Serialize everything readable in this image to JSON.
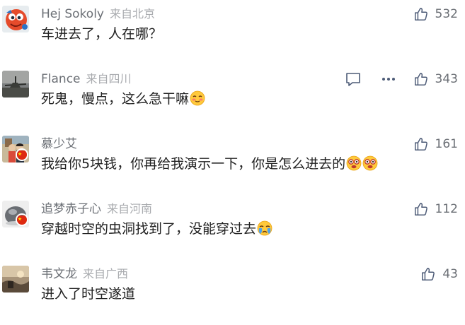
{
  "comments": [
    {
      "username": "Hej Sokoly",
      "location": "来自北京",
      "text": "车进去了，人在哪？",
      "likes": "532",
      "emoji_count": 0,
      "avatar_icon": "red-cartoon-avatar"
    },
    {
      "username": "Flance",
      "location": "来自四川",
      "text": "死鬼，慢点，这么急干嘛",
      "likes": "343",
      "emoji_count": 1,
      "emoji_name": "blushing-emoji",
      "avatar_icon": "airplane-photo-avatar",
      "actions": [
        "reply-icon",
        "more-icon"
      ]
    },
    {
      "username": "慕少艾",
      "location": "",
      "text": "我给你5块钱，你再给我演示一下，你是怎么进去的",
      "likes": "161",
      "emoji_count": 2,
      "emoji_name": "monocle-emoji",
      "avatar_icon": "couple-photo-avatar",
      "flag": "china-flag-icon"
    },
    {
      "username": "追梦赤子心",
      "location": "来自河南",
      "text": "穿越时空的虫洞找到了，没能穿过去",
      "likes": "112",
      "emoji_count": 1,
      "emoji_name": "crying-emoji",
      "avatar_icon": "gray-ball-avatar",
      "flag": "china-flag-icon"
    },
    {
      "username": "韦文龙",
      "location": "来自广西",
      "text": "进入了时空遂道",
      "likes": "43",
      "emoji_count": 0,
      "avatar_icon": "sunset-photo-avatar"
    }
  ],
  "colors": {
    "username": "#6b6f75",
    "location": "#a9abaf",
    "text": "#222222",
    "icon": "#4d5b77"
  }
}
